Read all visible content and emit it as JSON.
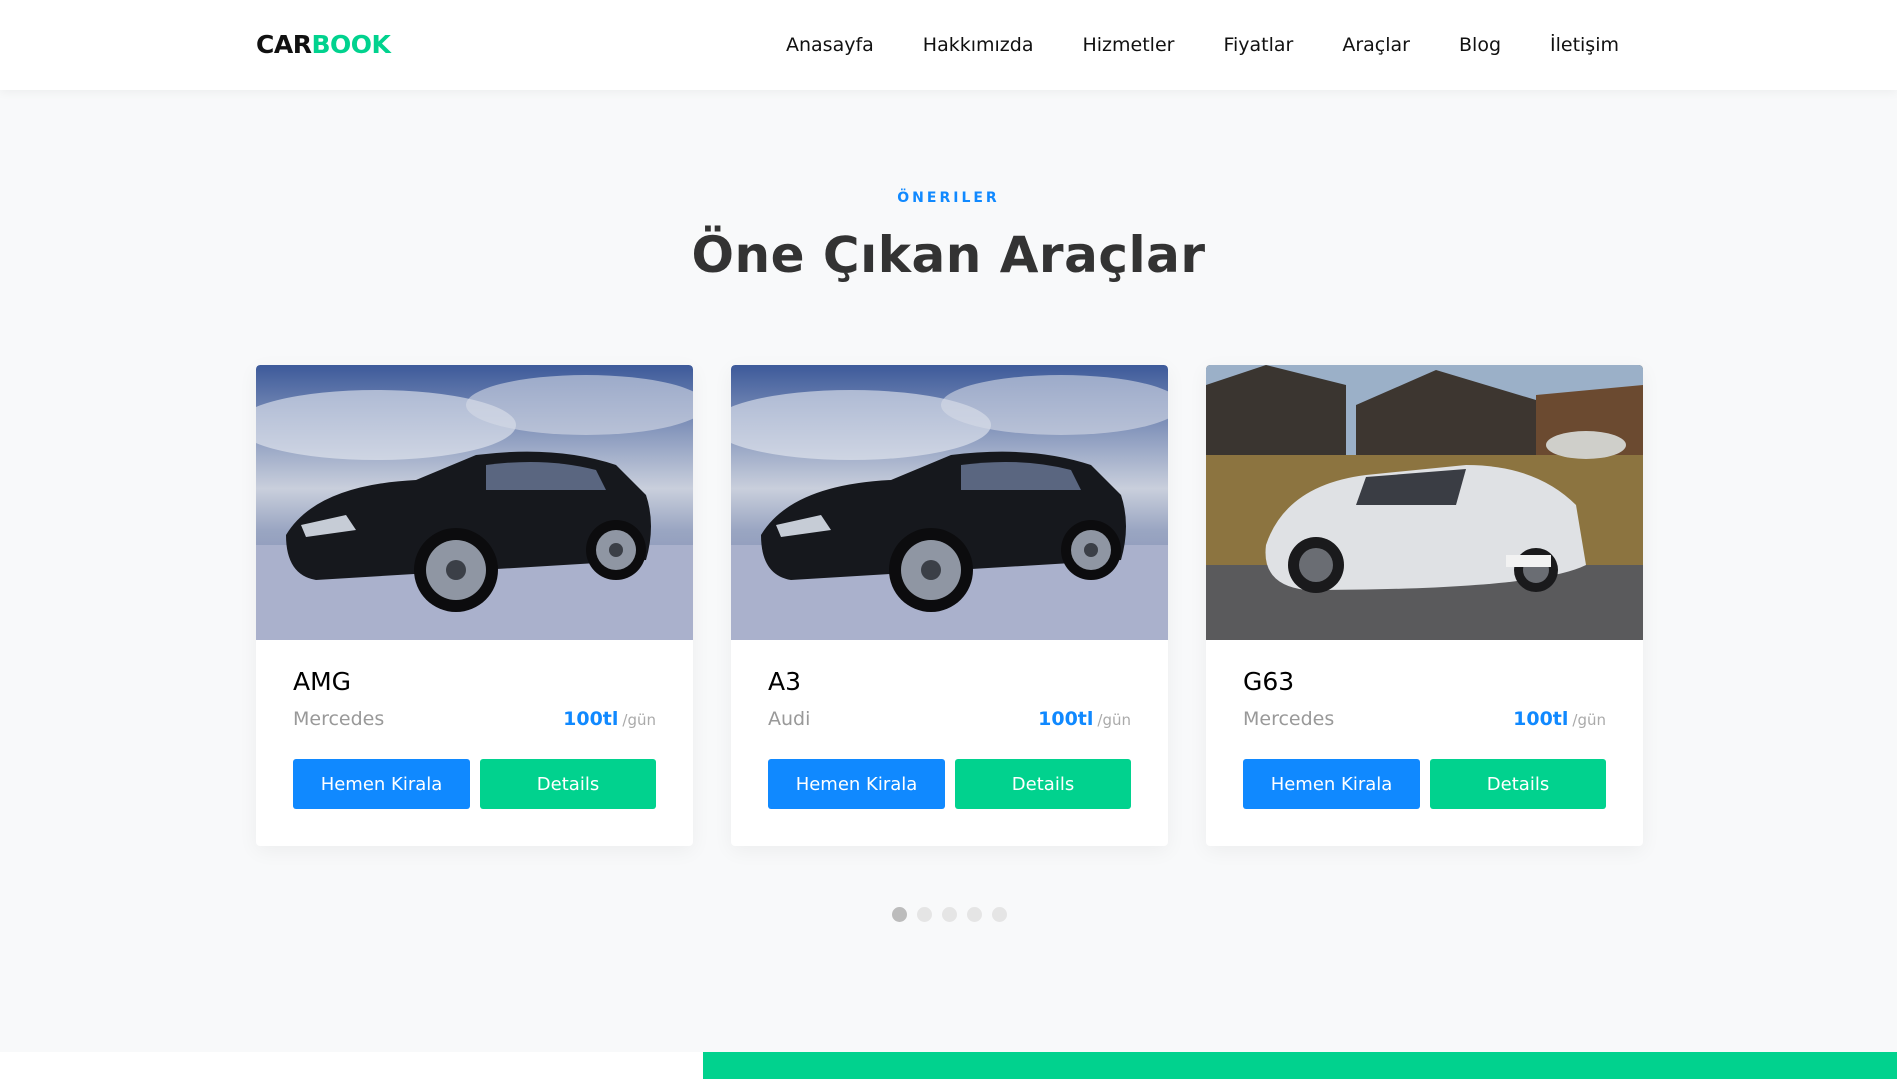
{
  "header": {
    "logo_part1": "CAR",
    "logo_part2": "BOOK",
    "nav": [
      "Anasayfa",
      "Hakkımızda",
      "Hizmetler",
      "Fiyatlar",
      "Araçlar",
      "Blog",
      "İletişim"
    ]
  },
  "section": {
    "subheading": "ÖNERILER",
    "heading": "Öne Çıkan Araçlar"
  },
  "cars": [
    {
      "name": "AMG",
      "brand": "Mercedes",
      "price": "100tl",
      "unit": "/gün",
      "rent_label": "Hemen Kirala",
      "details_label": "Details",
      "image": "black-sports-car-photo"
    },
    {
      "name": "A3",
      "brand": "Audi",
      "price": "100tl",
      "unit": "/gün",
      "rent_label": "Hemen Kirala",
      "details_label": "Details",
      "image": "black-sports-car-photo"
    },
    {
      "name": "G63",
      "brand": "Mercedes",
      "price": "100tl",
      "unit": "/gün",
      "rent_label": "Hemen Kirala",
      "details_label": "Details",
      "image": "white-supercar-photo"
    }
  ],
  "carousel": {
    "dot_count": 5,
    "active_index": 0
  },
  "colors": {
    "primary": "#1089ff",
    "secondary": "#01d28e",
    "background": "#f8f9fa"
  }
}
